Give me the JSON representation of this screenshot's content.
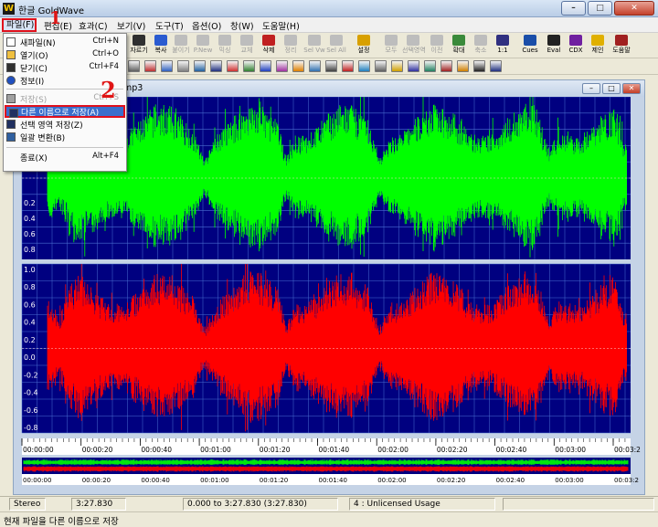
{
  "window": {
    "title": "한글 GoldWave",
    "logo": "W",
    "controls": {
      "minimize": "–",
      "maximize": "□",
      "close": "✕"
    }
  },
  "menubar": {
    "items": [
      "파일(F)",
      "편집(E)",
      "효과(C)",
      "보기(V)",
      "도구(T)",
      "옵션(O)",
      "창(W)",
      "도움말(H)"
    ],
    "active": "파일(F)"
  },
  "toolbar_main": [
    {
      "label": "자르기",
      "icon": "scissors-icon",
      "enabled": true
    },
    {
      "label": "복사",
      "icon": "copy-icon",
      "enabled": true
    },
    {
      "label": "붙이기",
      "icon": "paste-icon",
      "enabled": false
    },
    {
      "label": "P.New",
      "icon": "paste-new-icon",
      "enabled": false
    },
    {
      "label": "믹싱",
      "icon": "mix-icon",
      "enabled": false
    },
    {
      "label": "교체",
      "icon": "replace-icon",
      "enabled": false
    },
    {
      "label": "삭제",
      "icon": "delete-icon",
      "enabled": true
    },
    {
      "label": "정리",
      "icon": "trim-icon",
      "enabled": false
    },
    {
      "label": "Sel Vw",
      "icon": "select-view-icon",
      "enabled": false
    },
    {
      "label": "Sel All",
      "icon": "select-all-icon",
      "enabled": false
    },
    {
      "label": "설정",
      "icon": "settings-icon",
      "enabled": true
    },
    {
      "label": "모두",
      "icon": "zoom-all-icon",
      "enabled": false
    },
    {
      "label": "선택영역",
      "icon": "zoom-selection-icon",
      "enabled": false
    },
    {
      "label": "이전",
      "icon": "zoom-previous-icon",
      "enabled": false
    },
    {
      "label": "확대",
      "icon": "zoom-in-icon",
      "enabled": true
    },
    {
      "label": "축소",
      "icon": "zoom-out-icon",
      "enabled": false
    },
    {
      "label": "1:1",
      "icon": "zoom-1-1-icon",
      "enabled": true
    },
    {
      "label": "Cues",
      "icon": "cues-icon",
      "enabled": true
    },
    {
      "label": "Eval",
      "icon": "eval-icon",
      "enabled": true
    },
    {
      "label": "CDX",
      "icon": "cdx-icon",
      "enabled": true
    },
    {
      "label": "제인",
      "icon": "help-question-icon",
      "enabled": true
    },
    {
      "label": "도움말",
      "icon": "help-book-icon",
      "enabled": true
    }
  ],
  "file_menu": [
    {
      "label": "새파일(N)",
      "shortcut": "Ctrl+N",
      "icon": "new-file-icon",
      "enabled": true
    },
    {
      "label": "열기(O)",
      "shortcut": "Ctrl+O",
      "icon": "open-folder-icon",
      "enabled": true
    },
    {
      "label": "닫기(C)",
      "shortcut": "Ctrl+F4",
      "icon": "close-x-icon",
      "enabled": true
    },
    {
      "label": "정보(I)",
      "shortcut": "",
      "icon": "info-icon",
      "enabled": true
    },
    {
      "label": "저장(S)",
      "shortcut": "Ctrl+S",
      "icon": "save-icon",
      "enabled": false
    },
    {
      "label": "다른 이름으로 저장(A)",
      "shortcut": "",
      "icon": "save-as-icon",
      "enabled": true,
      "selected": true
    },
    {
      "label": "선택 영역 저장(Z)",
      "shortcut": "",
      "icon": "save-selection-icon",
      "enabled": true
    },
    {
      "label": "일괄 변환(B)",
      "shortcut": "",
      "icon": "batch-convert-icon",
      "enabled": true
    },
    {
      "label": "종료(X)",
      "shortcut": "Alt+F4",
      "icon": "",
      "enabled": true
    }
  ],
  "annotations": {
    "step1": "1",
    "step2": "2"
  },
  "document": {
    "title_suffix": "mp3",
    "channels": [
      {
        "name": "left",
        "color": "#00ff00",
        "axis_labels": [
          "0.2",
          "0.4",
          "0.6",
          "0.8"
        ]
      },
      {
        "name": "right",
        "color": "#ff0000",
        "axis_labels": [
          "1.0",
          "0.8",
          "0.6",
          "0.4",
          "0.2",
          "0.0",
          "-0.2",
          "-0.4",
          "-0.6",
          "-0.8"
        ]
      }
    ],
    "background_color": "#000080",
    "grid_color": "#4a6fd0",
    "timeline": [
      "00:00:00",
      "00:00:20",
      "00:00:40",
      "00:01:00",
      "00:01:20",
      "00:01:40",
      "00:02:00",
      "00:02:20",
      "00:02:40",
      "00:03:00",
      "00:03:2"
    ],
    "overview_timeline": [
      "00:00:00",
      "00:00:20",
      "00:00:40",
      "00:01:00",
      "00:01:20",
      "00:01:40",
      "00:02:00",
      "00:02:20",
      "00:02:40",
      "00:03:00",
      "00:03:2"
    ]
  },
  "status": {
    "channels": "Stereo",
    "length": "3:27.830",
    "selection": "0.000 to 3:27.830 (3:27.830)",
    "license": "4 : Unlicensed Usage"
  },
  "hint": "현재 파일을 다른 이름으로 저장"
}
